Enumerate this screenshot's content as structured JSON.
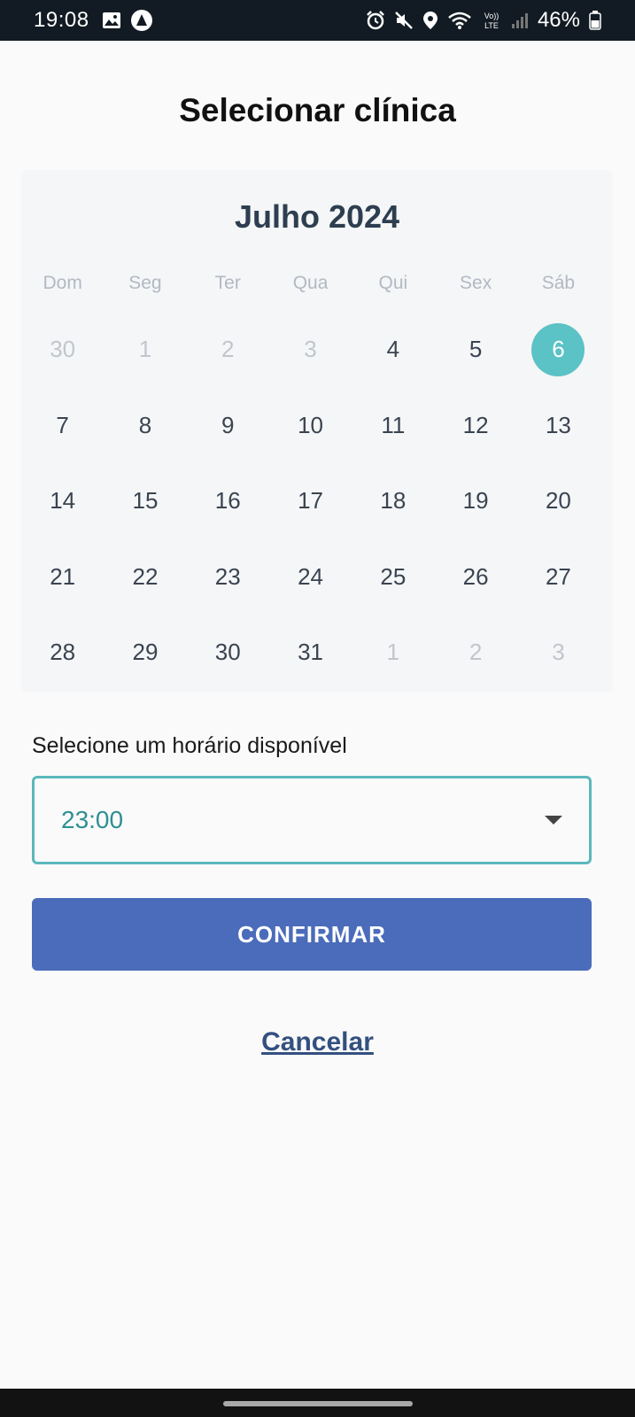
{
  "status_bar": {
    "time": "19:08",
    "battery": "46%",
    "icons_left": [
      "image-icon",
      "app-notification-icon"
    ],
    "icons_right": [
      "alarm-icon",
      "mute-icon",
      "location-icon",
      "wifi-icon",
      "volte-icon",
      "signal-icon",
      "battery-icon"
    ]
  },
  "page": {
    "title": "Selecionar clínica"
  },
  "calendar": {
    "month_label": "Julho 2024",
    "weekdays": [
      "Dom",
      "Seg",
      "Ter",
      "Qua",
      "Qui",
      "Sex",
      "Sáb"
    ],
    "days": [
      {
        "label": "30",
        "muted": true
      },
      {
        "label": "1",
        "muted": true
      },
      {
        "label": "2",
        "muted": true
      },
      {
        "label": "3",
        "muted": true
      },
      {
        "label": "4"
      },
      {
        "label": "5"
      },
      {
        "label": "6",
        "selected": true
      },
      {
        "label": "7"
      },
      {
        "label": "8"
      },
      {
        "label": "9"
      },
      {
        "label": "10"
      },
      {
        "label": "11"
      },
      {
        "label": "12"
      },
      {
        "label": "13"
      },
      {
        "label": "14"
      },
      {
        "label": "15"
      },
      {
        "label": "16"
      },
      {
        "label": "17"
      },
      {
        "label": "18"
      },
      {
        "label": "19"
      },
      {
        "label": "20"
      },
      {
        "label": "21"
      },
      {
        "label": "22"
      },
      {
        "label": "23"
      },
      {
        "label": "24"
      },
      {
        "label": "25"
      },
      {
        "label": "26"
      },
      {
        "label": "27"
      },
      {
        "label": "28"
      },
      {
        "label": "29"
      },
      {
        "label": "30"
      },
      {
        "label": "31"
      },
      {
        "label": "1",
        "muted": true
      },
      {
        "label": "2",
        "muted": true
      },
      {
        "label": "3",
        "muted": true
      }
    ],
    "selected_color": "#5bc2c6"
  },
  "time_slot": {
    "label": "Selecione um horário disponível",
    "selected_value": "23:00",
    "border_color": "#5bb8bc"
  },
  "actions": {
    "confirm_label": "CONFIRMAR",
    "confirm_color": "#4b6cba",
    "cancel_label": "Cancelar"
  }
}
